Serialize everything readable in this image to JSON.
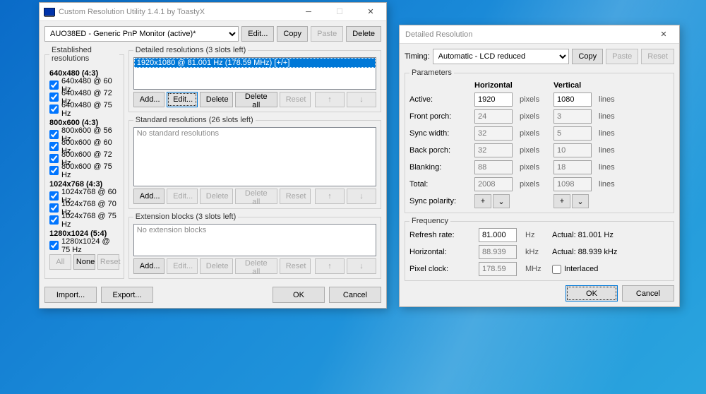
{
  "win1": {
    "title": "Custom Resolution Utility 1.4.1 by ToastyX",
    "monitor": "AUO38ED - Generic PnP Monitor (active)*",
    "topbtns": {
      "edit": "Edit...",
      "copy": "Copy",
      "paste": "Paste",
      "delete": "Delete"
    },
    "established": {
      "legend": "Established resolutions",
      "groups": [
        {
          "header": "640x480 (4:3)",
          "items": [
            "640x480 @ 60 Hz",
            "640x480 @ 72 Hz",
            "640x480 @ 75 Hz"
          ]
        },
        {
          "header": "800x600 (4:3)",
          "items": [
            "800x600 @ 56 Hz",
            "800x600 @ 60 Hz",
            "800x600 @ 72 Hz",
            "800x600 @ 75 Hz"
          ]
        },
        {
          "header": "1024x768 (4:3)",
          "items": [
            "1024x768 @ 60 Hz",
            "1024x768 @ 70 Hz",
            "1024x768 @ 75 Hz"
          ]
        },
        {
          "header": "1280x1024 (5:4)",
          "items": [
            "1280x1024 @ 75 Hz"
          ]
        }
      ],
      "btns": {
        "all": "All",
        "none": "None",
        "reset": "Reset"
      }
    },
    "detailed": {
      "legend": "Detailed resolutions (3 slots left)",
      "item": "1920x1080 @ 81.001 Hz (178.59 MHz) [+/+]",
      "btns": {
        "add": "Add...",
        "edit": "Edit...",
        "delete": "Delete",
        "deleteall": "Delete all",
        "reset": "Reset"
      }
    },
    "standard": {
      "legend": "Standard resolutions (26 slots left)",
      "empty": "No standard resolutions",
      "btns": {
        "add": "Add...",
        "edit": "Edit...",
        "delete": "Delete",
        "deleteall": "Delete all",
        "reset": "Reset"
      }
    },
    "extension": {
      "legend": "Extension blocks (3 slots left)",
      "empty": "No extension blocks",
      "btns": {
        "add": "Add...",
        "edit": "Edit...",
        "delete": "Delete",
        "deleteall": "Delete all",
        "reset": "Reset"
      }
    },
    "footer": {
      "import": "Import...",
      "export": "Export...",
      "ok": "OK",
      "cancel": "Cancel"
    }
  },
  "win2": {
    "title": "Detailed Resolution",
    "timing_label": "Timing:",
    "timing": "Automatic - LCD reduced",
    "copy": "Copy",
    "paste": "Paste",
    "reset": "Reset",
    "params": {
      "legend": "Parameters",
      "hh": "Horizontal",
      "hv": "Vertical",
      "rows": {
        "active": {
          "l": "Active:",
          "h": "1920",
          "uh": "pixels",
          "v": "1080",
          "uv": "lines"
        },
        "front": {
          "l": "Front porch:",
          "h": "24",
          "uh": "pixels",
          "v": "3",
          "uv": "lines"
        },
        "sync": {
          "l": "Sync width:",
          "h": "32",
          "uh": "pixels",
          "v": "5",
          "uv": "lines"
        },
        "back": {
          "l": "Back porch:",
          "h": "32",
          "uh": "pixels",
          "v": "10",
          "uv": "lines"
        },
        "blank": {
          "l": "Blanking:",
          "h": "88",
          "uh": "pixels",
          "v": "18",
          "uv": "lines"
        },
        "total": {
          "l": "Total:",
          "h": "2008",
          "uh": "pixels",
          "v": "1098",
          "uv": "lines"
        },
        "pol": {
          "l": "Sync polarity:"
        }
      }
    },
    "freq": {
      "legend": "Frequency",
      "refresh": {
        "l": "Refresh rate:",
        "v": "81.000",
        "u": "Hz",
        "a": "Actual: 81.001 Hz"
      },
      "horiz": {
        "l": "Horizontal:",
        "v": "88.939",
        "u": "kHz",
        "a": "Actual: 88.939 kHz"
      },
      "pixel": {
        "l": "Pixel clock:",
        "v": "178.59",
        "u": "MHz"
      },
      "interlaced": "Interlaced"
    },
    "ok": "OK",
    "cancel": "Cancel"
  }
}
